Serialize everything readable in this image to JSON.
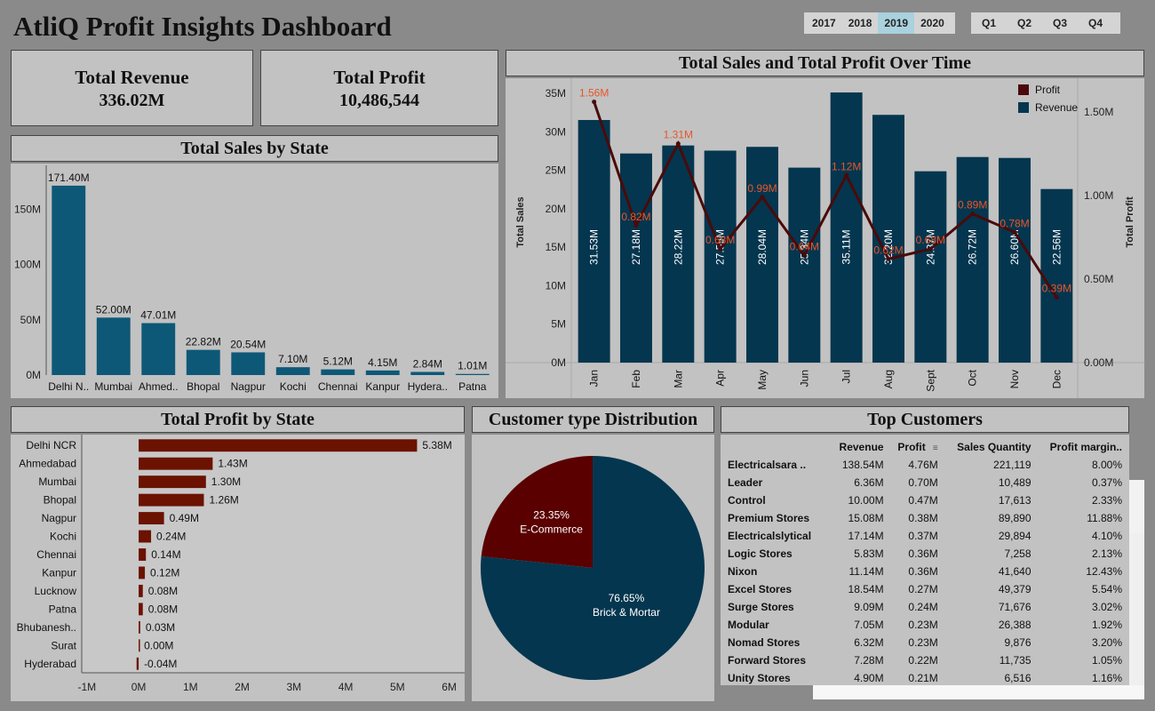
{
  "dashboard": {
    "title": "AtliQ Profit Insights Dashboard"
  },
  "filters": {
    "years": [
      "2017",
      "2018",
      "2019",
      "2020"
    ],
    "selected_year": "2019",
    "quarters": [
      "Q1",
      "Q2",
      "Q3",
      "Q4"
    ]
  },
  "kpis": {
    "revenue_label": "Total Revenue",
    "revenue_value": "336.02M",
    "profit_label": "Total Profit",
    "profit_value": "10,486,544"
  },
  "panels": {
    "sales_by_state": "Total Sales by State",
    "sales_profit_time": "Total Sales and Total Profit Over Time",
    "profit_by_state": "Total Profit by State",
    "customer_type": "Customer type Distribution",
    "top_customers": "Top Customers"
  },
  "colors": {
    "sales_bar": "#0e5877",
    "revenue_bar": "#04364f",
    "profit_line": "#4a0a0a",
    "profit_label": "#e8562a",
    "profit_bar": "#6b1200",
    "ecommerce": "#5a0000",
    "brick_mortar": "#04364f"
  },
  "chart_data": [
    {
      "type": "bar",
      "categories": [
        "Delhi N..",
        "Mumbai",
        "Ahmed..",
        "Bhopal",
        "Nagpur",
        "Kochi",
        "Chennai",
        "Kanpur",
        "Hydera..",
        "Patna"
      ],
      "values": [
        171.4,
        52.0,
        47.01,
        22.82,
        20.54,
        7.1,
        5.12,
        4.15,
        2.84,
        1.01
      ],
      "value_labels": [
        "171.40M",
        "52.00M",
        "47.01M",
        "22.82M",
        "20.54M",
        "7.10M",
        "5.12M",
        "4.15M",
        "2.84M",
        "1.01M"
      ],
      "yticks": [
        0,
        50,
        100,
        150
      ],
      "ytick_labels": [
        "0M",
        "50M",
        "100M",
        "150M"
      ],
      "ylim": [
        0,
        185
      ],
      "unit": "M"
    },
    {
      "type": "bar",
      "categories": [
        "Jan",
        "Feb",
        "Mar",
        "Apr",
        "May",
        "Jun",
        "Jul",
        "Aug",
        "Sept",
        "Oct",
        "Nov",
        "Dec"
      ],
      "series": [
        {
          "name": "Revenue",
          "type": "bar",
          "axis": "left",
          "values": [
            31.53,
            27.18,
            28.22,
            27.55,
            28.04,
            25.34,
            35.11,
            32.2,
            24.87,
            26.72,
            26.6,
            22.56
          ],
          "labels": [
            "31.53M",
            "27.18M",
            "28.22M",
            "27.55M",
            "28.04M",
            "25.34M",
            "35.11M",
            "32.20M",
            "24.87M",
            "26.72M",
            "26.60M",
            "22.56M"
          ]
        },
        {
          "name": "Profit",
          "type": "line",
          "axis": "right",
          "values": [
            1.56,
            0.82,
            1.31,
            0.68,
            0.99,
            0.64,
            1.12,
            0.62,
            0.68,
            0.89,
            0.78,
            0.39
          ],
          "labels": [
            "1.56M",
            "0.82M",
            "1.31M",
            "0.68M",
            "0.99M",
            "0.64M",
            "1.12M",
            "0.62M",
            "0.68M",
            "0.89M",
            "0.78M",
            "0.39M"
          ]
        }
      ],
      "ylabel": "Total Sales",
      "y2label": "Total Profit",
      "ylim": [
        0,
        36.5
      ],
      "y2lim": [
        0,
        1.68
      ],
      "yticks": [
        0,
        5,
        10,
        15,
        20,
        25,
        30,
        35
      ],
      "ytick_labels": [
        "0M",
        "5M",
        "10M",
        "15M",
        "20M",
        "25M",
        "30M",
        "35M"
      ],
      "y2ticks": [
        0,
        0.5,
        1.0,
        1.5
      ],
      "y2tick_labels": [
        "0.00M",
        "0.50M",
        "1.00M",
        "1.50M"
      ],
      "legend": [
        "Profit",
        "Revenue"
      ],
      "legend_position": "top-right"
    },
    {
      "type": "bar",
      "orientation": "horizontal",
      "categories": [
        "Delhi NCR",
        "Ahmedabad",
        "Mumbai",
        "Bhopal",
        "Nagpur",
        "Kochi",
        "Chennai",
        "Kanpur",
        "Lucknow",
        "Patna",
        "Bhubanesh..",
        "Surat",
        "Hyderabad"
      ],
      "values": [
        5.38,
        1.43,
        1.3,
        1.26,
        0.49,
        0.24,
        0.14,
        0.12,
        0.08,
        0.08,
        0.03,
        0.0,
        -0.04
      ],
      "value_labels": [
        "5.38M",
        "1.43M",
        "1.30M",
        "1.26M",
        "0.49M",
        "0.24M",
        "0.14M",
        "0.12M",
        "0.08M",
        "0.08M",
        "0.03M",
        "0.00M",
        "-0.04M"
      ],
      "xticks": [
        -1,
        0,
        1,
        2,
        3,
        4,
        5,
        6
      ],
      "xtick_labels": [
        "-1M",
        "0M",
        "1M",
        "2M",
        "3M",
        "4M",
        "5M",
        "6M"
      ],
      "xlim": [
        -1.1,
        6.3
      ]
    },
    {
      "type": "pie",
      "slices": [
        {
          "label": "E-Commerce",
          "value": 23.35,
          "pct_label": "23.35%"
        },
        {
          "label": "Brick & Mortar",
          "value": 76.65,
          "pct_label": "76.65%"
        }
      ]
    }
  ],
  "top_customers": {
    "columns": [
      "",
      "Revenue",
      "Profit",
      "Sales Quantity",
      "Profit margin.."
    ],
    "sort_icon": "sort-descending-icon",
    "rows": [
      [
        "Electricalsara ..",
        "138.54M",
        "4.76M",
        "221,119",
        "8.00%"
      ],
      [
        "Leader",
        "6.36M",
        "0.70M",
        "10,489",
        "0.37%"
      ],
      [
        "Control",
        "10.00M",
        "0.47M",
        "17,613",
        "2.33%"
      ],
      [
        "Premium Stores",
        "15.08M",
        "0.38M",
        "89,890",
        "11.88%"
      ],
      [
        "Electricalslytical",
        "17.14M",
        "0.37M",
        "29,894",
        "4.10%"
      ],
      [
        "Logic Stores",
        "5.83M",
        "0.36M",
        "7,258",
        "2.13%"
      ],
      [
        "Nixon",
        "11.14M",
        "0.36M",
        "41,640",
        "12.43%"
      ],
      [
        "Excel Stores",
        "18.54M",
        "0.27M",
        "49,379",
        "5.54%"
      ],
      [
        "Surge Stores",
        "9.09M",
        "0.24M",
        "71,676",
        "3.02%"
      ],
      [
        "Modular",
        "7.05M",
        "0.23M",
        "26,388",
        "1.92%"
      ],
      [
        "Nomad Stores",
        "6.32M",
        "0.23M",
        "9,876",
        "3.20%"
      ],
      [
        "Forward Stores",
        "7.28M",
        "0.22M",
        "11,735",
        "1.05%"
      ],
      [
        "Unity Stores",
        "4.90M",
        "0.21M",
        "6,516",
        "1.16%"
      ]
    ]
  }
}
